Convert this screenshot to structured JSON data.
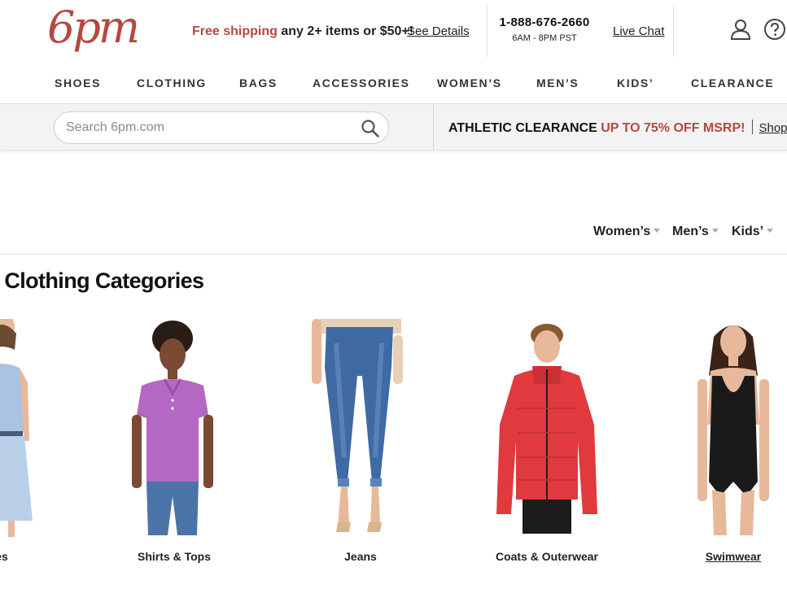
{
  "header": {
    "logo_text": "6pm",
    "promo_accent": "Free shipping",
    "promo_rest": " any 2+ items or $50+!",
    "see_details": "See Details",
    "phone": "1-888-676-2660",
    "hours": "6AM - 8PM PST",
    "live_chat": "Live Chat"
  },
  "nav": {
    "items": [
      "SHOES",
      "CLOTHING",
      "BAGS",
      "ACCESSORIES",
      "WOMEN’S",
      "MEN’S",
      "KIDS’",
      "CLEARANCE"
    ]
  },
  "search": {
    "placeholder": "Search 6pm.com"
  },
  "banner": {
    "dark": "ATHLETIC CLEARANCE ",
    "red": "UP TO 75% OFF MSRP!",
    "shop": "Shop t"
  },
  "subnav": {
    "items": [
      "Women’s",
      "Men’s",
      "Kids’"
    ]
  },
  "page": {
    "heading": "s Clothing Categories"
  },
  "categories": [
    {
      "label": "es",
      "icon": "dress-image"
    },
    {
      "label": "Shirts & Tops",
      "icon": "polo-shirt-image"
    },
    {
      "label": "Jeans",
      "icon": "jeans-image"
    },
    {
      "label": "Coats & Outerwear",
      "icon": "puffer-jacket-image"
    },
    {
      "label": "Swimwear",
      "icon": "swimsuit-image"
    }
  ],
  "colors": {
    "brand": "#b5483f",
    "polo": "#b468c4",
    "denim": "#3f6aa3",
    "jacket": "#e03a3e",
    "swimsuit": "#1a1a1a",
    "skin": "#e8b89a"
  }
}
